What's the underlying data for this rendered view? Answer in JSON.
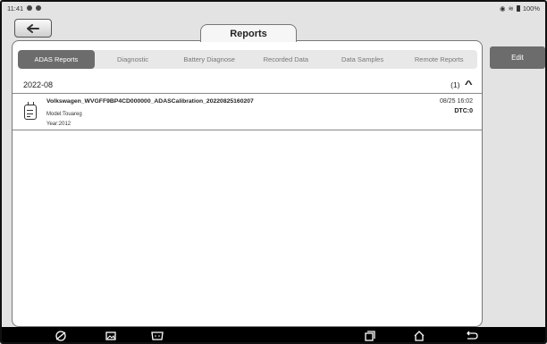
{
  "status": {
    "time": "11:41",
    "battery": "100%"
  },
  "header": {
    "back_icon": "back-arrow-icon",
    "title": "Reports"
  },
  "tabs": [
    {
      "label": "ADAS Reports",
      "active": true
    },
    {
      "label": "Diagnostic",
      "active": false
    },
    {
      "label": "Battery Diagnose",
      "active": false
    },
    {
      "label": "Recorded Data",
      "active": false
    },
    {
      "label": "Data Samples",
      "active": false
    },
    {
      "label": "Remote Reports",
      "active": false
    }
  ],
  "group": {
    "date": "2022-08",
    "count": "(1)"
  },
  "report": {
    "title": "Volkswagen_WVGFF9BP4CD000000_ADASCalibration_20220825160207",
    "model": "Model:Touareg",
    "year": "Year:2012",
    "datetime": "08/25 16:02",
    "dtc": "DTC:0"
  },
  "actions": {
    "edit_label": "Edit"
  },
  "navbar": {
    "icons": [
      "browser-icon",
      "gallery-icon",
      "vci-icon",
      "recent-apps-icon",
      "home-icon",
      "back-icon"
    ]
  },
  "colors": {
    "active_tab": "#6c6c6c",
    "panel_bg": "#ffffff",
    "frame_bg": "#e3e3e3"
  }
}
